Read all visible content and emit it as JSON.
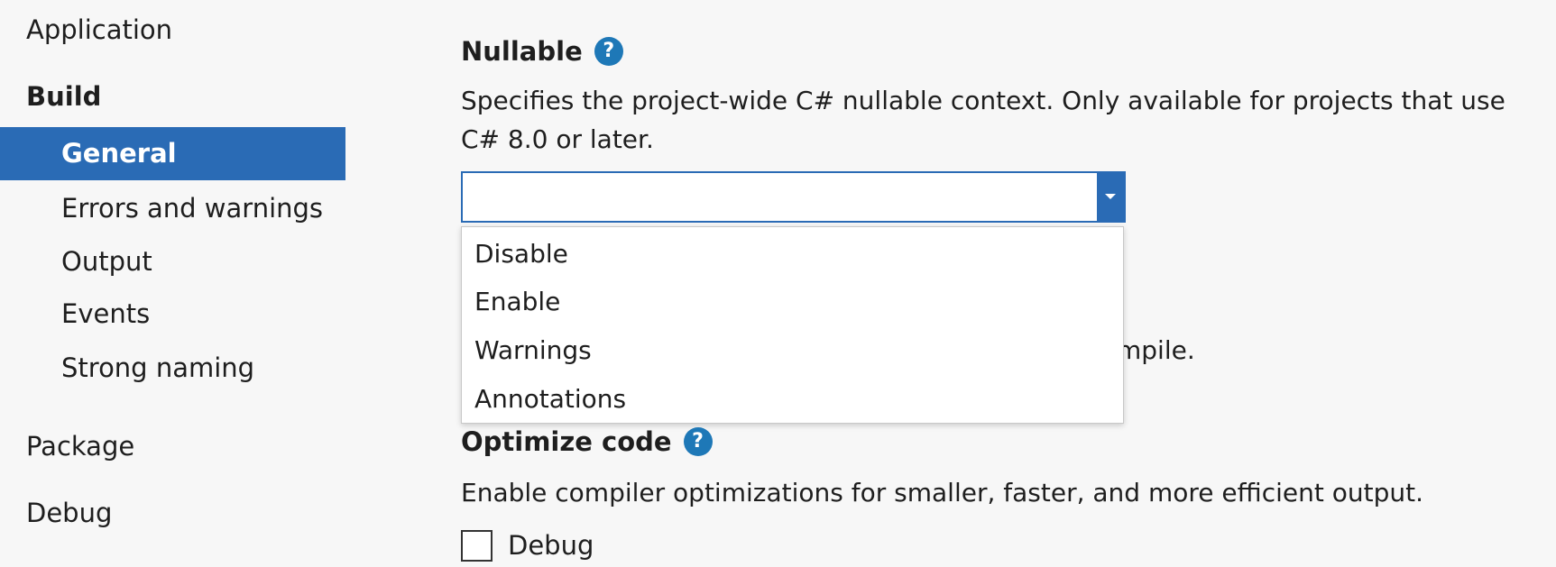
{
  "sidebar": {
    "items": [
      {
        "label": "Application"
      },
      {
        "label": "Build"
      },
      {
        "label": "General"
      },
      {
        "label": "Errors and warnings"
      },
      {
        "label": "Output"
      },
      {
        "label": "Events"
      },
      {
        "label": "Strong naming"
      },
      {
        "label": "Package"
      },
      {
        "label": "Debug"
      }
    ],
    "selected_color": "#2a6bb5"
  },
  "nullable": {
    "title": "Nullable",
    "help_glyph": "?",
    "description": "Specifies the project-wide C# nullable context. Only available for projects that use C# 8.0 or later.",
    "selected_value": "",
    "options": [
      "Disable",
      "Enable",
      "Warnings",
      "Annotations"
    ]
  },
  "obscured_text": "mpile.",
  "optimize": {
    "title": "Optimize code",
    "help_glyph": "?",
    "description": "Enable compiler optimizations for smaller, faster, and more efficient output.",
    "checkbox_label": "Debug",
    "checked": false
  },
  "colors": {
    "accent": "#2a6bb5",
    "help_icon": "#1e78b7",
    "background": "#f7f7f7"
  }
}
